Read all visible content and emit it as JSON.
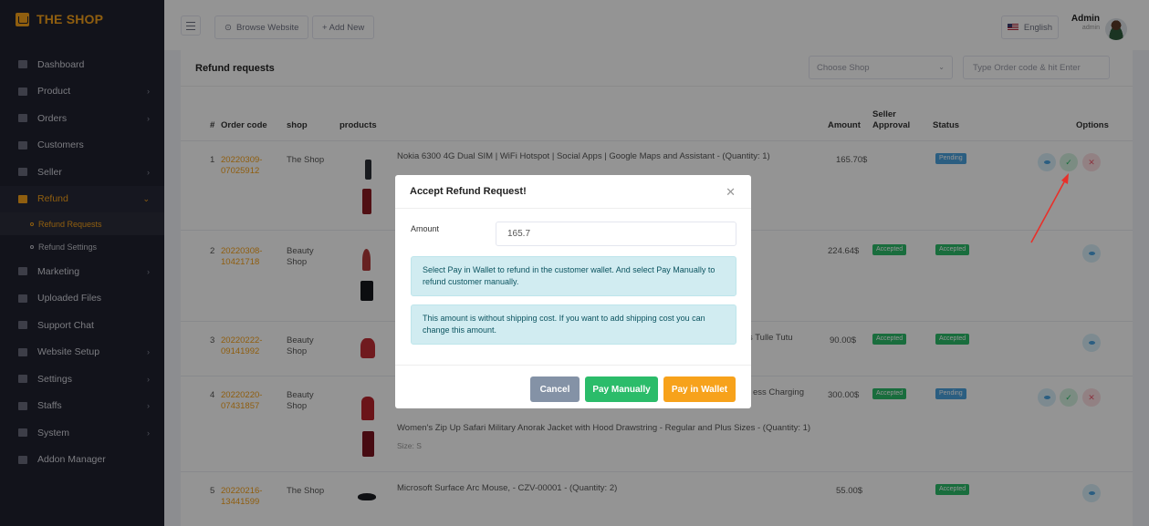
{
  "brand": {
    "name": "THE SHOP"
  },
  "sidebar": {
    "items": [
      {
        "label": "Dashboard",
        "chevron": false
      },
      {
        "label": "Product",
        "chevron": true
      },
      {
        "label": "Orders",
        "chevron": true
      },
      {
        "label": "Customers",
        "chevron": false
      },
      {
        "label": "Seller",
        "chevron": true
      },
      {
        "label": "Refund",
        "chevron": true,
        "active": true
      }
    ],
    "sub_items": [
      {
        "label": "Refund Requests",
        "active": true
      },
      {
        "label": "Refund Settings",
        "active": false
      }
    ],
    "items_after": [
      {
        "label": "Marketing",
        "chevron": true
      },
      {
        "label": "Uploaded Files",
        "chevron": false
      },
      {
        "label": "Support Chat",
        "chevron": false
      },
      {
        "label": "Website Setup",
        "chevron": true
      },
      {
        "label": "Settings",
        "chevron": true
      },
      {
        "label": "Staffs",
        "chevron": true
      },
      {
        "label": "System",
        "chevron": true
      },
      {
        "label": "Addon Manager",
        "chevron": false
      }
    ]
  },
  "topbar": {
    "browse_label": "Browse Website",
    "add_label": "+ Add New",
    "language": "English",
    "user_name": "Admin",
    "user_role": "admin"
  },
  "page": {
    "title": "Refund requests",
    "shop_select": "Choose Shop",
    "search_placeholder": "Type Order code & hit Enter"
  },
  "table": {
    "headers": {
      "num": "#",
      "order_code": "Order code",
      "shop": "shop",
      "products": "products",
      "amount": "Amount",
      "seller_approval_1": "Seller",
      "seller_approval_2": "Approval",
      "status": "Status",
      "options": "Options"
    },
    "rows": [
      {
        "num": "1",
        "code1": "20220309-",
        "code2": "07025912",
        "shop1": "The Shop",
        "shop2": "",
        "product": "Nokia 6300 4G Dual SIM | WiFi Hotspot | Social Apps | Google Maps and Assistant - (Quantity: 1)",
        "amount": "165.70$",
        "seller": "",
        "status": "Pending"
      },
      {
        "num": "2",
        "code1": "20220308-",
        "code2": "10421718",
        "shop1": "Beauty",
        "shop2": "Shop",
        "product": "",
        "amount": "224.64$",
        "seller": "Accepted",
        "status": "Accepted"
      },
      {
        "num": "3",
        "code1": "20220222-",
        "code2": "09141992",
        "shop1": "Beauty",
        "shop2": "Shop",
        "product": "s Tulle Tutu",
        "amount": "90.00$",
        "seller": "Accepted",
        "status": "Accepted"
      },
      {
        "num": "4",
        "code1": "20220220-",
        "code2": "07431857",
        "shop1": "Beauty",
        "shop2": "Shop",
        "product": "ess Charging",
        "product2": "Women's Zip Up Safari Military Anorak Jacket with Hood Drawstring - Regular and Plus Sizes - (Quantity: 1)",
        "size": "Size: S",
        "amount": "300.00$",
        "seller": "Accepted",
        "status": "Pending"
      },
      {
        "num": "5",
        "code1": "20220216-",
        "code2": "13441599",
        "shop1": "The Shop",
        "shop2": "",
        "product": "Microsoft Surface Arc Mouse, - CZV-00001 - (Quantity: 2)",
        "amount": "55.00$",
        "seller": "",
        "status": "Accepted"
      }
    ]
  },
  "modal": {
    "title": "Accept Refund Request!",
    "amount_label": "Amount",
    "amount_value": "165.7",
    "alert1": "Select Pay in Wallet to refund in the customer wallet. And select Pay Manually to refund customer manually.",
    "alert2": "This amount is without shipping cost. If you want to add shipping cost you can change this amount.",
    "cancel": "Cancel",
    "pay_manually": "Pay Manually",
    "pay_wallet": "Pay in Wallet"
  },
  "colors": {
    "accent": "#f7a21b",
    "sidebar_bg": "#1f2130",
    "success": "#2bbc6a",
    "info": "#4aa3df",
    "danger": "#ef5b6e",
    "annotation": "#e8302a"
  }
}
